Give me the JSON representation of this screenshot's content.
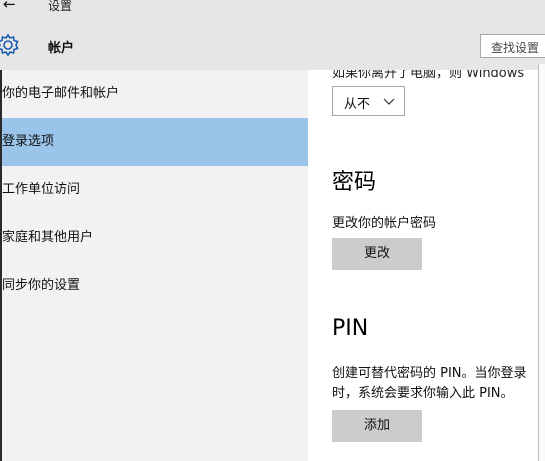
{
  "window": {
    "title": "设置"
  },
  "header": {
    "title": "帐户",
    "search_placeholder": "查找设置"
  },
  "sidebar": {
    "items": [
      {
        "label": "你的电子邮件和帐户",
        "selected": false
      },
      {
        "label": "登录选项",
        "selected": true
      },
      {
        "label": "工作单位访问",
        "selected": false
      },
      {
        "label": "家庭和其他用户",
        "selected": false
      },
      {
        "label": "同步你的设置",
        "selected": false
      }
    ]
  },
  "main": {
    "partial_text": "如果你离开了电脑，则 Windows",
    "require_signin": {
      "value": "从不"
    },
    "password": {
      "title": "密码",
      "description": "更改你的帐户密码",
      "button_label": "更改"
    },
    "pin": {
      "title": "PIN",
      "description_line1": "创建可替代密码的 PIN。当你登录",
      "description_line2": "时，系统会要求你输入此 PIN。",
      "button_label": "添加"
    }
  },
  "colors": {
    "accent_selected": "#9ac4ea",
    "header_bg": "#e6e6e6",
    "sidebar_bg": "#f2f2f2",
    "button_bg": "#cccccc"
  }
}
